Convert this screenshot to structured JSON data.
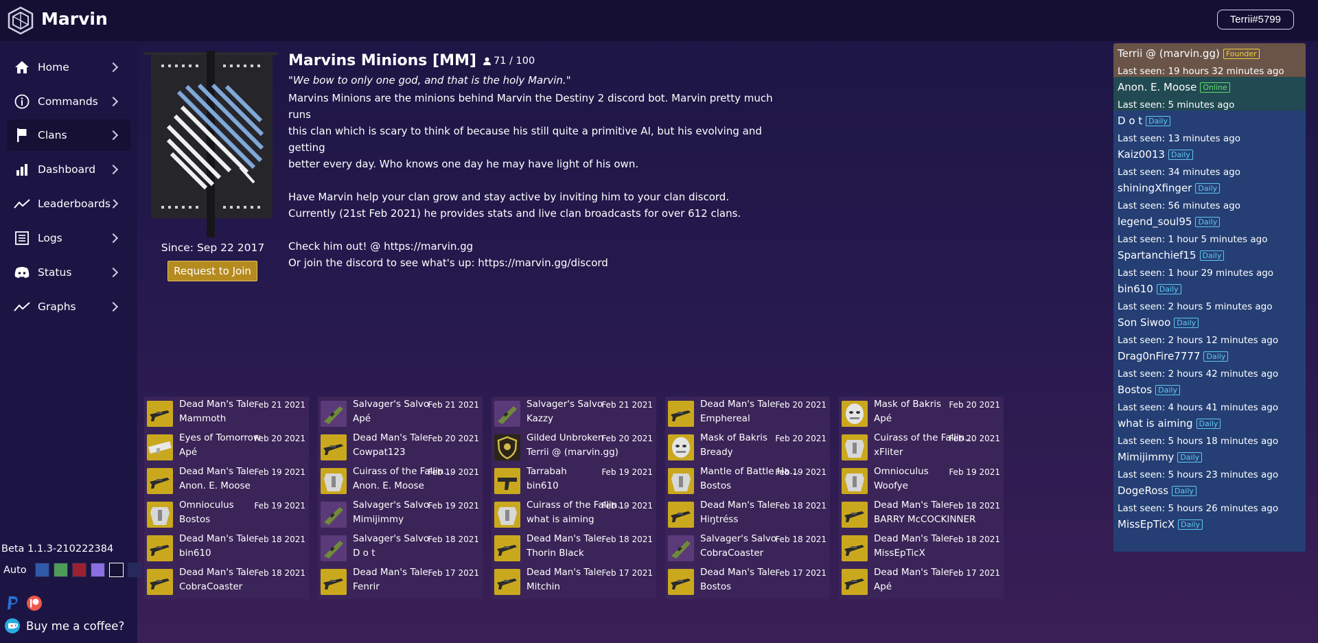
{
  "app": {
    "title": "Marvin",
    "user": "Terrii#5799"
  },
  "sidebar": {
    "items": [
      {
        "label": "Home",
        "icon": "home-icon"
      },
      {
        "label": "Commands",
        "icon": "info-icon"
      },
      {
        "label": "Clans",
        "icon": "banner-icon",
        "active": true
      },
      {
        "label": "Dashboard",
        "icon": "bar-chart-icon"
      },
      {
        "label": "Leaderboards",
        "icon": "trend-icon"
      },
      {
        "label": "Logs",
        "icon": "logs-icon"
      },
      {
        "label": "Status",
        "icon": "discord-icon"
      },
      {
        "label": "Graphs",
        "icon": "trend-icon"
      }
    ],
    "version": "Beta 1.1.3-210222384",
    "theme_label": "Auto",
    "themes": [
      "#2f5aa8",
      "#4f9b58",
      "#9a2230",
      "#8a6fe0",
      "#141232",
      "#26285e"
    ],
    "coffee_label": "Buy me a coffee?"
  },
  "clan": {
    "name": "Marvins Minions [MM]",
    "members": "71 / 100",
    "motto": "\"We bow to only one god, and that is the holy Marvin.\"",
    "description": [
      "Marvins Minions are the minions behind Marvin the Destiny 2 discord bot. Marvin pretty much runs",
      "this clan which is scary to think of because his still quite a primitive AI, but his evolving and getting",
      "better every day. Who knows one day he may have light of his own.",
      "",
      "Have Marvin help your clan grow and stay active by inviting him to your clan discord.",
      "Currently (21st Feb 2021) he provides stats and live clan broadcasts for over 612 clans.",
      "",
      "Check him out! @ https://marvin.gg",
      "Or join the discord to see what's up: https://marvin.gg/discord"
    ],
    "since": "Since: Sep 22 2017",
    "join_label": "Request to Join"
  },
  "broadcasts": [
    {
      "item": "Dead Man's Tale",
      "date": "Feb 21 2021",
      "player": "Mammoth",
      "icon": "gun-icon"
    },
    {
      "item": "Salvager's Salvo",
      "date": "Feb 21 2021",
      "player": "Apé",
      "icon": "launcher-icon"
    },
    {
      "item": "Salvager's Salvo",
      "date": "Feb 21 2021",
      "player": "Kazzy",
      "icon": "launcher-icon"
    },
    {
      "item": "Dead Man's Tale",
      "date": "Feb 20 2021",
      "player": "Emphereal",
      "icon": "gun-icon"
    },
    {
      "item": "Mask of Bakris",
      "date": "Feb 20 2021",
      "player": "Apé",
      "icon": "helmet-icon"
    },
    {
      "item": "Eyes of Tomorrow",
      "date": "Feb 20 2021",
      "player": "Apé",
      "icon": "rocket-icon"
    },
    {
      "item": "Dead Man's Tale",
      "date": "Feb 20 2021",
      "player": "Cowpat123",
      "icon": "gun-icon"
    },
    {
      "item": "Gilded Unbroken",
      "date": "Feb 20 2021",
      "player": "Terrii @ (marvin.gg)",
      "icon": "shield-icon"
    },
    {
      "item": "Mask of Bakris",
      "date": "Feb 20 2021",
      "player": "Bready",
      "icon": "helmet-icon"
    },
    {
      "item": "Cuirass of the Falling Star",
      "date": "Feb 20 2021",
      "player": "xFliter",
      "icon": "armor-icon"
    },
    {
      "item": "Dead Man's Tale",
      "date": "Feb 19 2021",
      "player": "Anon. E. Moose",
      "icon": "gun-icon"
    },
    {
      "item": "Cuirass of the Falling Star",
      "date": "Feb 19 2021",
      "player": "Anon. E. Moose",
      "icon": "armor-icon"
    },
    {
      "item": "Tarrabah",
      "date": "Feb 19 2021",
      "player": "bin610",
      "icon": "smg-icon"
    },
    {
      "item": "Mantle of Battle Harmony",
      "date": "Feb 19 2021",
      "player": "Bostos",
      "icon": "armor-icon"
    },
    {
      "item": "Omnioculus",
      "date": "Feb 19 2021",
      "player": "Woofye",
      "icon": "armor-icon"
    },
    {
      "item": "Omnioculus",
      "date": "Feb 19 2021",
      "player": "Bostos",
      "icon": "armor-icon"
    },
    {
      "item": "Salvager's Salvo",
      "date": "Feb 19 2021",
      "player": "Mimijimmy",
      "icon": "launcher-icon"
    },
    {
      "item": "Cuirass of the Falling Star",
      "date": "Feb 19 2021",
      "player": "what is aiming",
      "icon": "armor-icon"
    },
    {
      "item": "Dead Man's Tale",
      "date": "Feb 18 2021",
      "player": "Hiŋtréss",
      "icon": "gun-icon"
    },
    {
      "item": "Dead Man's Tale",
      "date": "Feb 18 2021",
      "player": "BARRY McCOCKINNER",
      "icon": "gun-icon"
    },
    {
      "item": "Dead Man's Tale",
      "date": "Feb 18 2021",
      "player": "bin610",
      "icon": "gun-icon"
    },
    {
      "item": "Salvager's Salvo",
      "date": "Feb 18 2021",
      "player": "D o t",
      "icon": "launcher-icon"
    },
    {
      "item": "Dead Man's Tale",
      "date": "Feb 18 2021",
      "player": "Thorin Black",
      "icon": "gun-icon"
    },
    {
      "item": "Salvager's Salvo",
      "date": "Feb 18 2021",
      "player": "CobraCoaster",
      "icon": "launcher-icon"
    },
    {
      "item": "Dead Man's Tale",
      "date": "Feb 18 2021",
      "player": "MissEpTicX",
      "icon": "gun-icon"
    },
    {
      "item": "Dead Man's Tale",
      "date": "Feb 18 2021",
      "player": "CobraCoaster",
      "icon": "gun-icon"
    },
    {
      "item": "Dead Man's Tale",
      "date": "Feb 17 2021",
      "player": "Fenrir",
      "icon": "gun-icon"
    },
    {
      "item": "Dead Man's Tale",
      "date": "Feb 17 2021",
      "player": "Mitchin",
      "icon": "gun-icon"
    },
    {
      "item": "Dead Man's Tale",
      "date": "Feb 17 2021",
      "player": "Bostos",
      "icon": "gun-icon"
    },
    {
      "item": "Dead Man's Tale",
      "date": "Feb 17 2021",
      "player": "Apé",
      "icon": "gun-icon"
    }
  ],
  "members": [
    {
      "name": "Terrii @ (marvin.gg)",
      "badge": "Founder",
      "seen": "Last seen: 19 hours 32 minutes ago",
      "type": "founder"
    },
    {
      "name": "Anon. E. Moose",
      "badge": "Online",
      "seen": "Last seen: 5 minutes ago",
      "type": "online"
    },
    {
      "name": "D o t",
      "badge": "Daily",
      "seen": "Last seen: 13 minutes ago",
      "type": "daily"
    },
    {
      "name": "Kaiz0013",
      "badge": "Daily",
      "seen": "Last seen: 34 minutes ago",
      "type": "daily"
    },
    {
      "name": "shiningXfinger",
      "badge": "Daily",
      "seen": "Last seen: 56 minutes ago",
      "type": "daily"
    },
    {
      "name": "legend_soul95",
      "badge": "Daily",
      "seen": "Last seen: 1 hour 5 minutes ago",
      "type": "daily"
    },
    {
      "name": "Spartanchief15",
      "badge": "Daily",
      "seen": "Last seen: 1 hour 29 minutes ago",
      "type": "daily"
    },
    {
      "name": "bin610",
      "badge": "Daily",
      "seen": "Last seen: 2 hours 5 minutes ago",
      "type": "daily"
    },
    {
      "name": "Son Siwoo",
      "badge": "Daily",
      "seen": "Last seen: 2 hours 12 minutes ago",
      "type": "daily"
    },
    {
      "name": "Drag0nFire7777",
      "badge": "Daily",
      "seen": "Last seen: 2 hours 42 minutes ago",
      "type": "daily"
    },
    {
      "name": "Bostos",
      "badge": "Daily",
      "seen": "Last seen: 4 hours 41 minutes ago",
      "type": "daily"
    },
    {
      "name": "what is aiming",
      "badge": "Daily",
      "seen": "Last seen: 5 hours 18 minutes ago",
      "type": "daily"
    },
    {
      "name": "Mimijimmy",
      "badge": "Daily",
      "seen": "Last seen: 5 hours 23 minutes ago",
      "type": "daily"
    },
    {
      "name": "DogeRoss",
      "badge": "Daily",
      "seen": "Last seen: 5 hours 26 minutes ago",
      "type": "daily"
    },
    {
      "name": "MissEpTicX",
      "badge": "Daily",
      "seen": "",
      "type": "daily"
    }
  ]
}
